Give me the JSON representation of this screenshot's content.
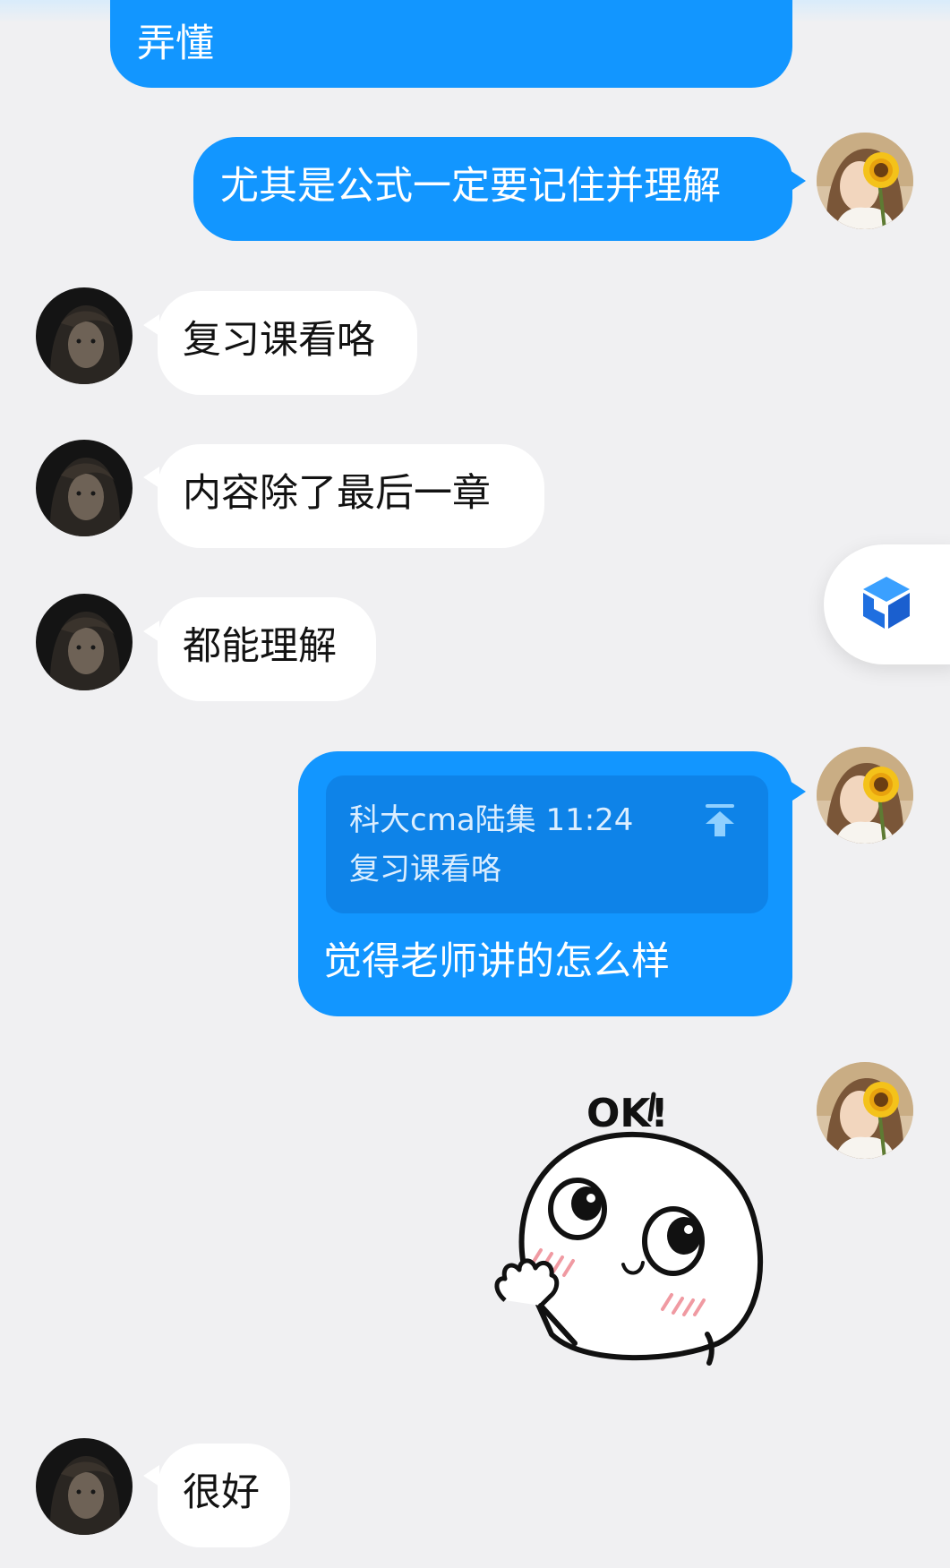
{
  "messages": [
    {
      "side": "out",
      "text": "弄懂"
    },
    {
      "side": "out",
      "text": "尤其是公式一定要记住并理解"
    },
    {
      "side": "in",
      "text": "复习课看咯"
    },
    {
      "side": "in",
      "text": "内容除了最后一章"
    },
    {
      "side": "in",
      "text": "都能理解"
    },
    {
      "side": "out",
      "quote": {
        "meta": "科大cma陆集 11:24",
        "text": "复习课看咯"
      },
      "text": "觉得老师讲的怎么样"
    },
    {
      "side": "out",
      "sticker": "ok-sticker",
      "sticker_text": "OK!"
    },
    {
      "side": "in",
      "text": "很好"
    }
  ],
  "icons": {
    "jump": "arrow-up-to-top-icon",
    "float": "cube-logo-icon"
  },
  "colors": {
    "background": "#f0f0f2",
    "outgoing_bubble": "#1296ff",
    "incoming_bubble": "#ffffff",
    "quote_box": "#0e83e8"
  }
}
